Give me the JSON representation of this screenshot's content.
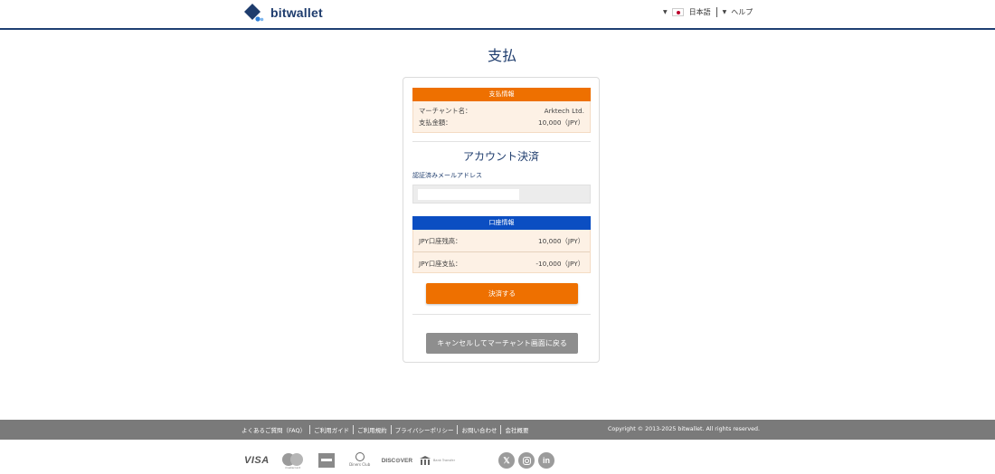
{
  "header": {
    "brand": "bitwallet",
    "language": "日本語",
    "help": "ヘルプ",
    "language_caret": "▼",
    "help_caret": "▼"
  },
  "page_title": "支払",
  "payment_info": {
    "heading": "支払情報",
    "merchant_label": "マーチャント名：",
    "merchant_value": "Arktech Ltd.",
    "amount_label": "支払金額：",
    "amount_value": "10,000（JPY）"
  },
  "account_section": {
    "title": "アカウント決済",
    "email_label": "認証済みメールアドレス",
    "email_value": ""
  },
  "account_info": {
    "heading": "口座情報",
    "balance_label": "JPY口座残高：",
    "balance_value": "10,000（JPY）",
    "payment_label": "JPY口座支払：",
    "payment_value": "-10,000（JPY）"
  },
  "buttons": {
    "pay": "決済する",
    "cancel": "キャンセルしてマーチャント画面に戻る"
  },
  "footer": {
    "links": [
      "よくあるご質問（FAQ）",
      "ご利用ガイド",
      "ご利用規約",
      "プライバシーポリシー",
      "お問い合わせ",
      "会社概要"
    ],
    "copyright": "Copyright © 2013-2025 bitwallet. All rights reserved.",
    "payment_brands": {
      "visa": "VISA",
      "mastercard": "mastercard",
      "diners": "Diners Club",
      "discover": "DISC⊙VER",
      "bank": "Bank Transfer"
    },
    "social": [
      "x-icon",
      "instagram-icon",
      "linkedin-icon"
    ]
  },
  "colors": {
    "brand_navy": "#1e3c6d",
    "orange": "#ee7000",
    "blue": "#0b4ec2",
    "cancel_gray": "#8e8e8e",
    "footer_gray": "#7a7a7a"
  }
}
